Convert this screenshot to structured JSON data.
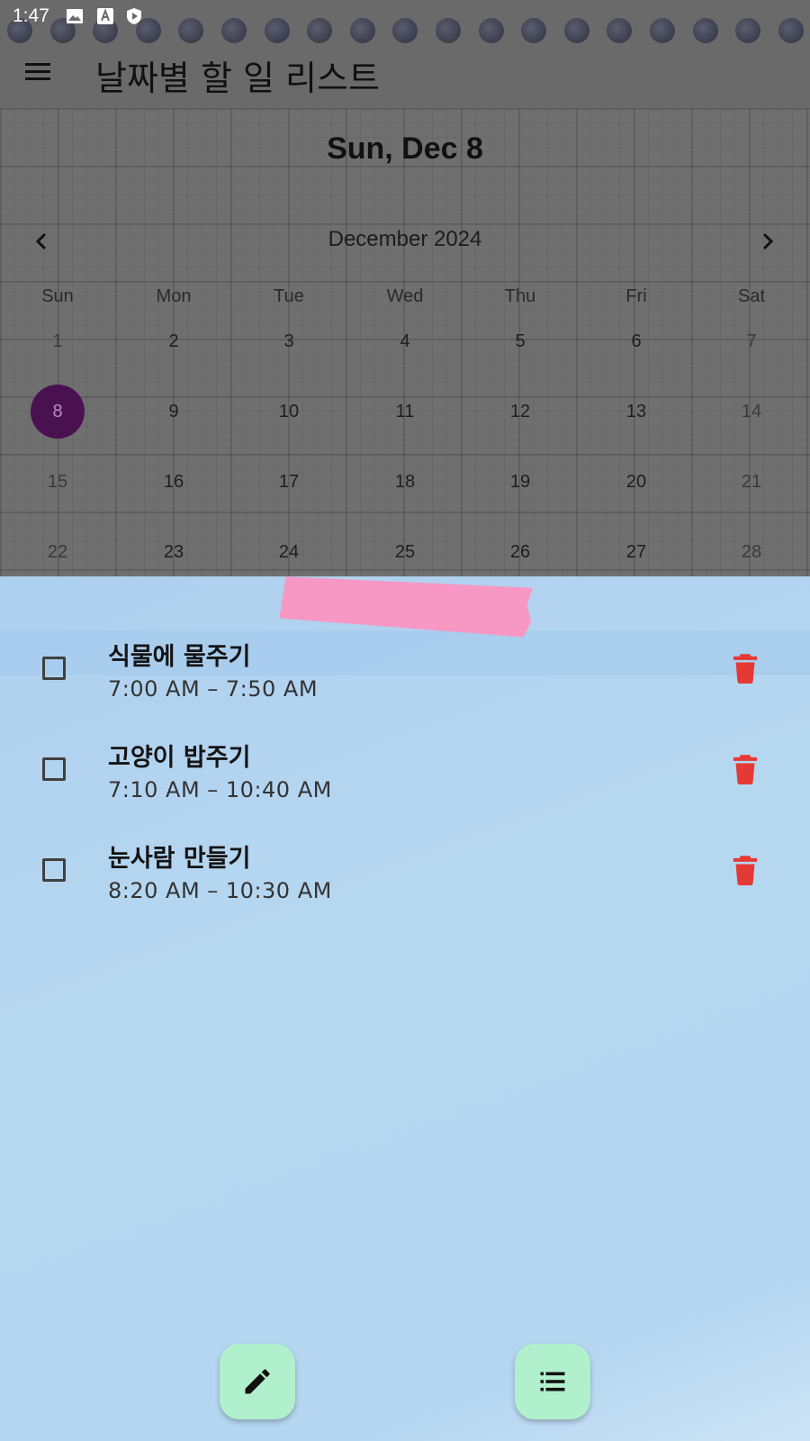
{
  "status_bar": {
    "time": "1:47",
    "icons": [
      "image-icon",
      "text-a-icon",
      "shield-play-icon"
    ]
  },
  "app_bar": {
    "title": "날짜별 할 일 리스트",
    "menu_icon": "menu-icon"
  },
  "calendar": {
    "selected_date_label": "Sun, Dec 8",
    "month_label": "December 2024",
    "prev_icon": "chevron-left-icon",
    "next_icon": "chevron-right-icon",
    "weekdays": [
      "Sun",
      "Mon",
      "Tue",
      "Wed",
      "Thu",
      "Fri",
      "Sat"
    ],
    "weeks": [
      [
        "1",
        "2",
        "3",
        "4",
        "5",
        "6",
        "7"
      ],
      [
        "8",
        "9",
        "10",
        "11",
        "12",
        "13",
        "14"
      ],
      [
        "15",
        "16",
        "17",
        "18",
        "19",
        "20",
        "21"
      ],
      [
        "22",
        "23",
        "24",
        "25",
        "26",
        "27",
        "28"
      ]
    ],
    "selected_day": "8",
    "selected_color": "#4a1150"
  },
  "tasks": [
    {
      "title": "식물에 물주기",
      "time": "7:00 AM – 7:50 AM",
      "checked": false
    },
    {
      "title": "고양이 밥주기",
      "time": "7:10 AM – 10:40 AM",
      "checked": false
    },
    {
      "title": "눈사람 만들기",
      "time": "8:20 AM – 10:30 AM",
      "checked": false
    }
  ],
  "fabs": [
    {
      "icon": "pencil-icon"
    },
    {
      "icon": "list-icon"
    }
  ],
  "colors": {
    "delete": "#e53935",
    "fab": "#b1f0cc",
    "tape": "#f797c4"
  }
}
